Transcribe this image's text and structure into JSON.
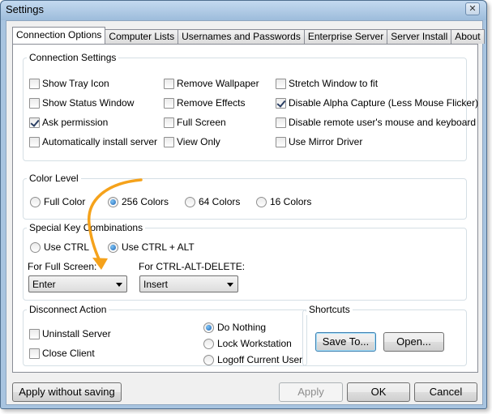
{
  "window": {
    "title": "Settings",
    "close_glyph": "✕"
  },
  "tabs": [
    {
      "label": "Connection Options",
      "active": true
    },
    {
      "label": "Computer Lists"
    },
    {
      "label": "Usernames and Passwords"
    },
    {
      "label": "Enterprise Server"
    },
    {
      "label": "Server Install"
    },
    {
      "label": "About"
    }
  ],
  "connection_settings": {
    "title": "Connection Settings",
    "options": [
      {
        "label": "Show Tray Icon",
        "checked": false
      },
      {
        "label": "Show Status Window",
        "checked": false
      },
      {
        "label": "Ask permission",
        "checked": true
      },
      {
        "label": "Automatically install server",
        "checked": false
      },
      {
        "label": "Remove Wallpaper",
        "checked": false
      },
      {
        "label": "Remove Effects",
        "checked": false
      },
      {
        "label": "Full Screen",
        "checked": false
      },
      {
        "label": "View Only",
        "checked": false
      },
      {
        "label": "Stretch Window to fit",
        "checked": false
      },
      {
        "label": "Disable Alpha Capture (Less Mouse Flicker)",
        "checked": true
      },
      {
        "label": "Disable remote user's mouse and keyboard",
        "checked": false
      },
      {
        "label": "Use Mirror Driver",
        "checked": false
      }
    ]
  },
  "color_level": {
    "title": "Color Level",
    "options": [
      {
        "label": "Full Color",
        "selected": false
      },
      {
        "label": "256 Colors",
        "selected": true
      },
      {
        "label": "64 Colors",
        "selected": false
      },
      {
        "label": "16 Colors",
        "selected": false
      }
    ]
  },
  "special_keys": {
    "title": "Special Key Combinations",
    "use_ctrl": {
      "label": "Use CTRL",
      "selected": false
    },
    "use_ctrl_alt": {
      "label": "Use CTRL + ALT",
      "selected": true
    },
    "full_screen_label": "For Full Screen:",
    "full_screen_value": "Enter",
    "ctrl_alt_del_label": "For CTRL-ALT-DELETE:",
    "ctrl_alt_del_value": "Insert"
  },
  "disconnect_action": {
    "title": "Disconnect Action",
    "uninstall_server": {
      "label": "Uninstall Server",
      "checked": false
    },
    "close_client": {
      "label": "Close Client",
      "checked": false
    },
    "radios": [
      {
        "label": "Do Nothing",
        "selected": true
      },
      {
        "label": "Lock Workstation",
        "selected": false
      },
      {
        "label": "Logoff Current User",
        "selected": false
      }
    ]
  },
  "shortcuts": {
    "title": "Shortcuts",
    "save_to": "Save To...",
    "open": "Open..."
  },
  "footer": {
    "apply_without_saving": "Apply without saving",
    "apply": "Apply",
    "ok": "OK",
    "cancel": "Cancel"
  },
  "colors": {
    "annotation_arrow": "#f5a21b",
    "radio_dot": "#1e64b4"
  }
}
